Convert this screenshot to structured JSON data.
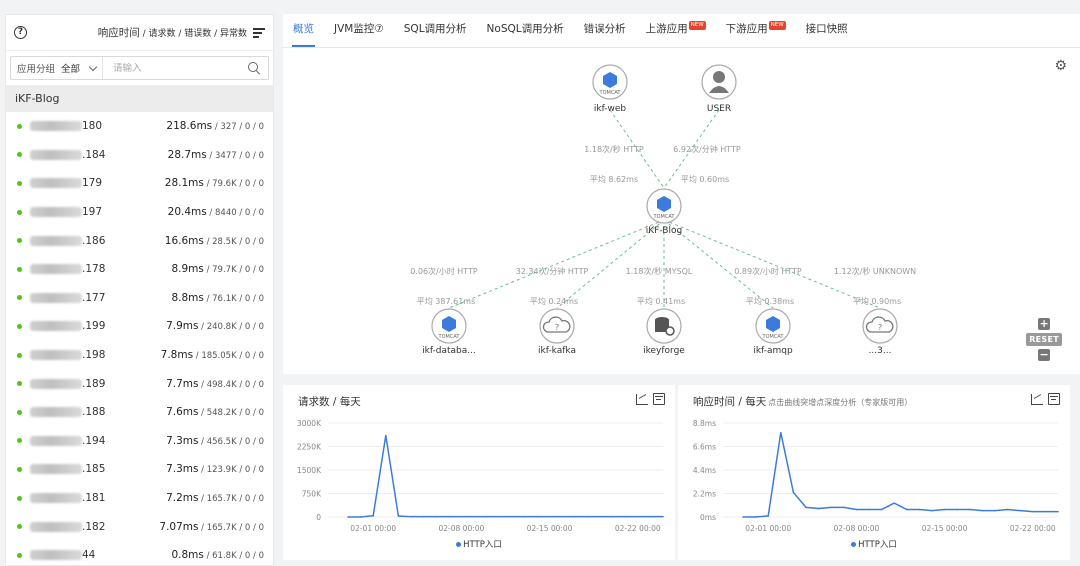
{
  "sidebar": {
    "header_metrics_prefix": "响应时间",
    "header_metrics_rest": " / 请求数 / 错误数 / 异常数",
    "filter": {
      "group_label": "应用分组",
      "group_value": "全部",
      "search_placeholder": "请输入"
    },
    "app_name": "iKF-Blog",
    "instances": [
      {
        "ip_suffix": "180",
        "ms": "218.6ms",
        "rest": " / 327 / 0 / 0"
      },
      {
        "ip_suffix": ".184",
        "ms": "28.7ms",
        "rest": " / 3477 / 0 / 0"
      },
      {
        "ip_suffix": "179",
        "ms": "28.1ms",
        "rest": " / 79.6K / 0 / 0"
      },
      {
        "ip_suffix": "197",
        "ms": "20.4ms",
        "rest": " / 8440 / 0 / 0"
      },
      {
        "ip_suffix": ".186",
        "ms": "16.6ms",
        "rest": " / 28.5K / 0 / 0"
      },
      {
        "ip_suffix": ".178",
        "ms": "8.9ms",
        "rest": " / 79.7K / 0 / 0"
      },
      {
        "ip_suffix": ".177",
        "ms": "8.8ms",
        "rest": " / 76.1K / 0 / 0"
      },
      {
        "ip_suffix": ".199",
        "ms": "7.9ms",
        "rest": " / 240.8K / 0 / 0"
      },
      {
        "ip_suffix": ".198",
        "ms": "7.8ms",
        "rest": " / 185.05K / 0 / 0"
      },
      {
        "ip_suffix": ".189",
        "ms": "7.7ms",
        "rest": " / 498.4K / 0 / 0"
      },
      {
        "ip_suffix": ".188",
        "ms": "7.6ms",
        "rest": " / 548.2K / 0 / 0"
      },
      {
        "ip_suffix": ".194",
        "ms": "7.3ms",
        "rest": " / 456.5K / 0 / 0"
      },
      {
        "ip_suffix": ".185",
        "ms": "7.3ms",
        "rest": " / 123.9K / 0 / 0"
      },
      {
        "ip_suffix": ".181",
        "ms": "7.2ms",
        "rest": " / 165.7K / 0 / 0"
      },
      {
        "ip_suffix": ".182",
        "ms": "7.07ms",
        "rest": " / 165.7K / 0 / 0"
      },
      {
        "ip_suffix": "44",
        "ms": "0.8ms",
        "rest": " / 61.8K / 0 / 0"
      }
    ]
  },
  "tabs": [
    {
      "label": "概览",
      "active": true,
      "new": false
    },
    {
      "label": "JVM监控⑦",
      "active": false,
      "new": false
    },
    {
      "label": "SQL调用分析",
      "active": false,
      "new": false
    },
    {
      "label": "NoSQL调用分析",
      "active": false,
      "new": false
    },
    {
      "label": "错误分析",
      "active": false,
      "new": false
    },
    {
      "label": "上游应用",
      "active": false,
      "new": true
    },
    {
      "label": "下游应用",
      "active": false,
      "new": true
    },
    {
      "label": "接口快照",
      "active": false,
      "new": false
    }
  ],
  "new_badge": "NEW",
  "topology": {
    "center": {
      "name": "iKF-Blog",
      "badge": "TOMCAT"
    },
    "upstream": [
      {
        "name": "ikf-web",
        "badge": "TOMCAT",
        "rate": "1.18次/秒 HTTP",
        "avg": "平均 8.62ms"
      },
      {
        "name": "USER",
        "badge": "",
        "rate": "6.92次/分钟 HTTP",
        "avg": "平均 0.60ms"
      }
    ],
    "downstream": [
      {
        "name": "ikf-databa...",
        "badge": "TOMCAT",
        "rate": "0.06次/小时 HTTP",
        "avg": "平均 387.61ms"
      },
      {
        "name": "ikf-kafka",
        "badge": "",
        "rate": "32.34次/分钟 HTTP",
        "avg": "平均 0.24ms"
      },
      {
        "name": "ikeyforge",
        "badge": "",
        "rate": "1.18次/秒 MYSQL",
        "avg": "平均 0.41ms"
      },
      {
        "name": "ikf-amqp",
        "badge": "TOMCAT",
        "rate": "0.89次/小时 HTTP",
        "avg": "平均 0.38ms"
      },
      {
        "name": "...3...",
        "badge": "",
        "rate": "1.12次/秒 UNKNOWN",
        "avg": "平均 0.90ms"
      }
    ],
    "reset_label": "RESET"
  },
  "charts": {
    "requests": {
      "title": "请求数 / 每天",
      "subtitle": "",
      "legend": "HTTP入口"
    },
    "response": {
      "title": "响应时间 / 每天",
      "subtitle": "点击曲线突增点深度分析（专家版可用）",
      "legend": "HTTP入口"
    }
  },
  "chart_data": [
    {
      "type": "line",
      "title": "请求数 / 每天",
      "x": [
        "01-30",
        "01-31",
        "02-01",
        "02-02",
        "02-03",
        "02-04",
        "02-05",
        "02-06",
        "02-07",
        "02-08",
        "02-09",
        "02-10",
        "02-11",
        "02-12",
        "02-13",
        "02-14",
        "02-15",
        "02-16",
        "02-17",
        "02-18",
        "02-19",
        "02-20",
        "02-21",
        "02-22",
        "02-23",
        "02-24"
      ],
      "xticks": [
        "02-01 00:00",
        "02-08 00:00",
        "02-15 00:00",
        "02-22 00:00"
      ],
      "yticks": [
        "0",
        "750K",
        "1500K",
        "2250K",
        "3000K"
      ],
      "ylim": [
        0,
        3000000
      ],
      "series": [
        {
          "name": "HTTP入口",
          "values": [
            0,
            0,
            40000,
            2600000,
            30000,
            10000,
            10000,
            10000,
            10000,
            10000,
            10000,
            10000,
            10000,
            10000,
            10000,
            10000,
            10000,
            10000,
            10000,
            10000,
            10000,
            10000,
            10000,
            10000,
            10000,
            10000
          ]
        }
      ],
      "color": "#3c7bdc"
    },
    {
      "type": "line",
      "title": "响应时间 / 每天",
      "x": [
        "01-30",
        "01-31",
        "02-01",
        "02-02",
        "02-03",
        "02-04",
        "02-05",
        "02-06",
        "02-07",
        "02-08",
        "02-09",
        "02-10",
        "02-11",
        "02-12",
        "02-13",
        "02-14",
        "02-15",
        "02-16",
        "02-17",
        "02-18",
        "02-19",
        "02-20",
        "02-21",
        "02-22",
        "02-23",
        "02-24"
      ],
      "xticks": [
        "02-01 00:00",
        "02-08 00:00",
        "02-15 00:00",
        "02-22 00:00"
      ],
      "yticks": [
        "0ms",
        "2.2ms",
        "4.4ms",
        "6.6ms",
        "8.8ms"
      ],
      "ylim": [
        0,
        8.8
      ],
      "series": [
        {
          "name": "HTTP入口",
          "values": [
            0,
            0,
            0.1,
            7.9,
            2.3,
            0.9,
            0.8,
            0.9,
            0.9,
            0.7,
            0.7,
            0.7,
            1.3,
            0.7,
            0.7,
            0.6,
            0.7,
            0.7,
            0.7,
            0.6,
            0.6,
            0.7,
            0.6,
            0.5,
            0.5,
            0.5
          ]
        }
      ],
      "color": "#3c7bdc"
    }
  ]
}
